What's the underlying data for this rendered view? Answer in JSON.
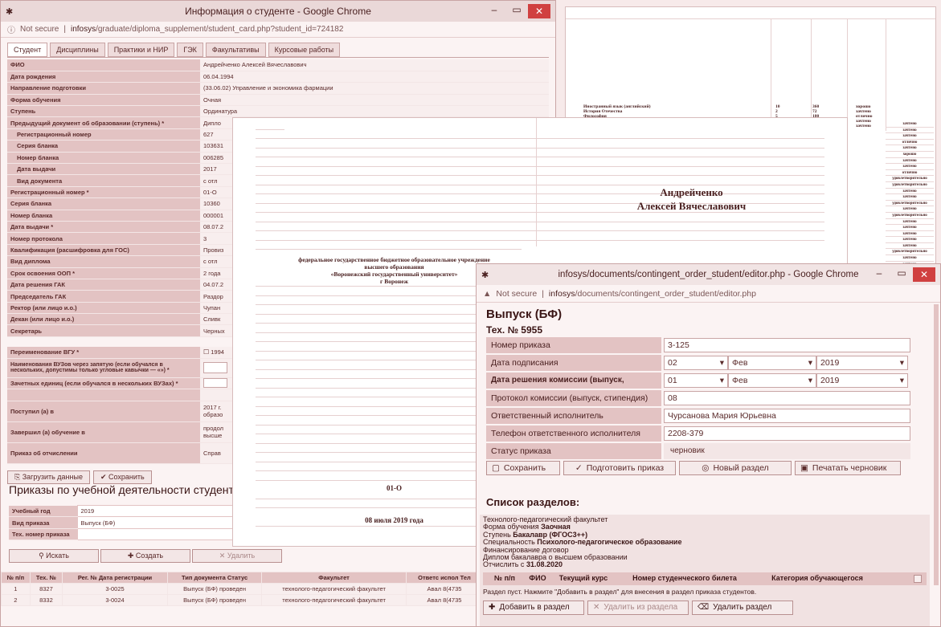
{
  "w1": {
    "title": "Информация о студенте - Google Chrome",
    "addr_ns": "Not secure",
    "addr_host": "infosys",
    "addr_path": "/graduate/diploma_supplement/student_card.php?student_id=724182",
    "tabs": [
      "Студент",
      "Дисциплины",
      "Практики и НИР",
      "ГЭК",
      "Факультативы",
      "Курсовые работы"
    ],
    "fields": [
      {
        "l": "ФИО",
        "v": "Андрейченко Алексей Вячеславович"
      },
      {
        "l": "Дата рождения",
        "v": "06.04.1994"
      },
      {
        "l": "Направление подготовки",
        "v": "(33.06.02) Управление и экономика фармации"
      },
      {
        "l": "Форма обучения",
        "v": "Очная"
      },
      {
        "l": "Ступень",
        "v": "Ординатура"
      },
      {
        "l": "Предыдущий документ об образовании (ступень) *",
        "v": "Дипло"
      },
      {
        "l": "Регистрационный номер",
        "v": "627"
      },
      {
        "l": "Серия бланка",
        "v": "103631"
      },
      {
        "l": "Номер бланка",
        "v": "006285"
      },
      {
        "l": "Дата выдачи",
        "v": "2017"
      },
      {
        "l": "Вид документа",
        "v": "с отл"
      },
      {
        "l": "Регистрационный номер *",
        "v": "01-О"
      },
      {
        "l": "Серия бланка",
        "v": "10360"
      },
      {
        "l": "Номер бланка",
        "v": "000001"
      },
      {
        "l": "Дата выдачи *",
        "v": "08.07.2"
      },
      {
        "l": "Номер протокола",
        "v": "3"
      },
      {
        "l": "Квалификация (расшифровка для ГОС)",
        "v": "Провиз"
      },
      {
        "l": "Вид диплома",
        "v": "с отл"
      },
      {
        "l": "Срок освоения ООП *",
        "v": "2 года"
      },
      {
        "l": "Дата решения ГАК",
        "v": "04.07.2"
      },
      {
        "l": "Председатель ГАК",
        "v": "Раздор"
      },
      {
        "l": "Ректор (или лицо и.о.)",
        "v": "Чупан"
      },
      {
        "l": "Декан (или лицо и.о.)",
        "v": "Сливк"
      },
      {
        "l": "Секретарь",
        "v": "Черных"
      }
    ],
    "rename_l": "Переименование ВГУ *",
    "rename_v": "1994",
    "vuz_l": "Наименования ВУЗов через запятую (если обучался в нескольких, допустимы только угловые кавычки — «»)  *",
    "zet_l": "Зачетных единиц (если обучался в нескольких ВУЗах) *",
    "post_l": "Поступил (а) в",
    "post_v1": "2017 г.",
    "post_v2": "образо",
    "zav_l": "Завершил (а) обучение в",
    "zav_v1": "продол",
    "zav_v2": "высше",
    "prik_l": "Приказ об отчислении",
    "prik_v": "Справ",
    "btn_load": "Загрузить данные",
    "btn_save": "Сохранить",
    "orders_heading": "Приказы по учебной деятельности студент",
    "ord_fields": [
      {
        "l": "Учебный год",
        "v": "2019"
      },
      {
        "l": "Вид приказа",
        "v": "Выпуск (БФ)"
      },
      {
        "l": "Тех. номер приказа",
        "v": ""
      }
    ],
    "btn_search": "Искать",
    "btn_create": "Создать",
    "btn_delete": "Удалить",
    "table_headers": [
      "№ п/п",
      "Тех. №",
      "Рег. № Дата регистрации",
      "Тип документа Статус",
      "Факультет",
      "Ответс испол Тел"
    ],
    "rows": [
      {
        "n": "1",
        "tech": "8327",
        "reg": "3-0025",
        "type": "Выпуск (БФ) проведен",
        "fac": "технолого-педагогический факультет",
        "resp": "Авал 8(4735"
      },
      {
        "n": "2",
        "tech": "8332",
        "reg": "3-0024",
        "type": "Выпуск (БФ) проведен",
        "fac": "технолого-педагогический факультет",
        "resp": "Авал 8(4735"
      }
    ]
  },
  "doc_back": {
    "rows": [
      {
        "name": "Иностранный язык (английский)",
        "ze": "10",
        "h": "360",
        "g": "хорошо"
      },
      {
        "name": "История Отечества",
        "ze": "2",
        "h": "72",
        "g": "зачтено"
      },
      {
        "name": "Философия",
        "ze": "5",
        "h": "180",
        "g": "отлично"
      },
      {
        "name": "Психология",
        "ze": "2",
        "h": "72",
        "g": "зачтено"
      },
      {
        "name": "Русский язык, для устной и письменной коммуникации",
        "ze": "2",
        "h": "72",
        "g": "зачтено"
      }
    ],
    "col_grades": [
      "зачтено",
      "зачтено",
      "зачтено",
      "отлично",
      "зачтено",
      "хорошо",
      "зачтено",
      "зачтено",
      "отлично",
      "удовлетворительно",
      "удовлетворительно",
      "зачтено",
      "зачтено",
      "удовлетворительно",
      "зачтено",
      "удовлетворительно",
      "зачтено",
      "зачтено",
      "зачтено",
      "зачтено",
      "зачтено",
      "удовлетворительно",
      "зачтено",
      "зачтено"
    ]
  },
  "doc_front": {
    "surname": "Андрейченко",
    "name": "Алексей Вячеславович",
    "inst_l1": "федеральное государственное  бюджетное образовательное учреждение",
    "inst_l2": "высшего образования",
    "inst_l3": "«Воронежский государственный университет»",
    "inst_l4": "г Воронеж",
    "regnum": "01-О",
    "date": "08 июля 2019 года"
  },
  "w2": {
    "title": "infosys/documents/contingent_order_student/editor.php - Google Chrome",
    "addr_ns": "Not secure",
    "addr_host": "infosys",
    "addr_path": "/documents/contingent_order_student/editor.php",
    "heading": "Выпуск (БФ)",
    "tech": "Тех. № 5955",
    "f_order_l": "Номер приказа",
    "f_order_v": "3-125",
    "f_sign_l": "Дата подписания",
    "f_sign_d": "02",
    "f_sign_m": "Фев",
    "f_sign_y": "2019",
    "f_dec_l": "Дата решения комиссии (выпуск, стипендия)",
    "f_dec_d": "01",
    "f_dec_m": "Фев",
    "f_dec_y": "2019",
    "f_prot_l": "Протокол комиссии (выпуск, стипендия)",
    "f_prot_v": "08",
    "f_resp_l": "Ответственный исполнитель",
    "f_resp_v": "Чурсанова Мария Юрьевна",
    "f_tel_l": "Телефон ответственного исполнителя",
    "f_tel_v": "2208-379",
    "f_stat_l": "Статус приказа",
    "f_stat_v": "черновик",
    "btn_save": "Сохранить",
    "btn_prep": "Подготовить приказ",
    "btn_new": "Новый раздел",
    "btn_print": "Печатать черновик",
    "sections_heading": "Список разделов:",
    "sec_l1": "Технолого-педагогический факультет",
    "sec_l2a": "Форма обучения ",
    "sec_l2b": "Заочная",
    "sec_l3a": "Ступень ",
    "sec_l3b": "Бакалавр (ФГОС3++)",
    "sec_l4a": "Специальность ",
    "sec_l4b": "Психолого-педагогическое образование",
    "sec_l5": "Финансирование договор",
    "sec_l6": "Диплом бакалавра о высшем образовании",
    "sec_l7a": "Отчислить с ",
    "sec_l7b": "31.08.2020",
    "tbl_headers": [
      "№ п/п",
      "ФИО",
      "Текущий курс",
      "Номер студенческого билета",
      "Категория обучающегося"
    ],
    "empty_msg": "Раздел пуст. Нажмите \"Добавить в раздел\" для внесения в раздел приказа студентов.",
    "btn_add": "Добавить в раздел",
    "btn_remove": "Удалить из раздела",
    "btn_delsec": "Удалить раздел"
  }
}
